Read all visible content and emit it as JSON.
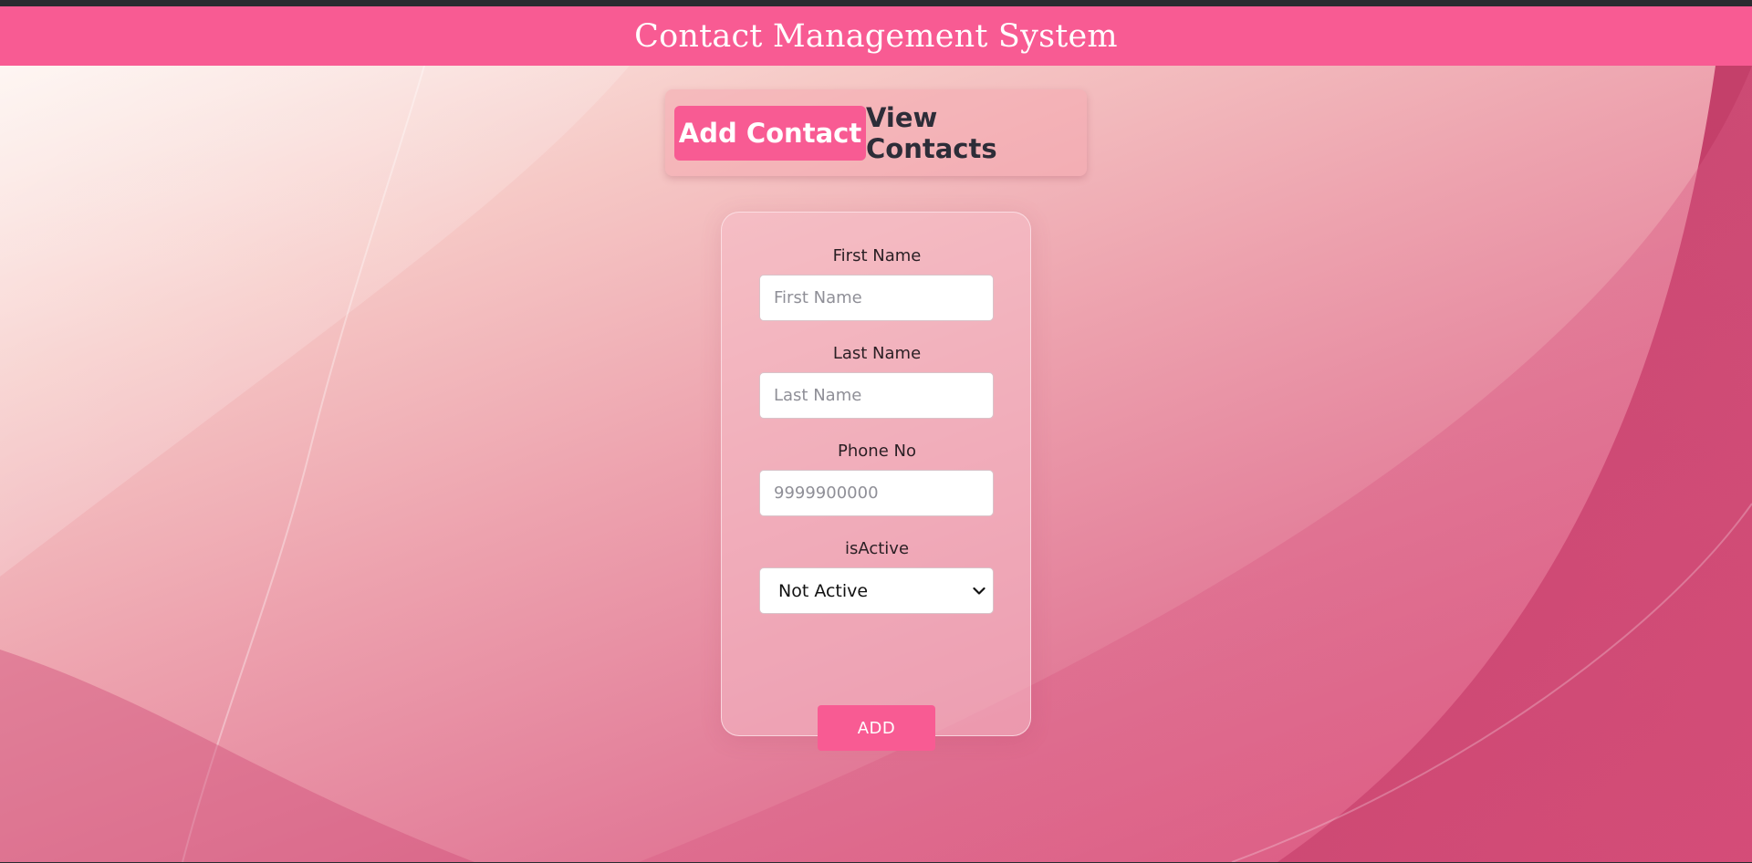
{
  "header": {
    "title": "Contact Management System"
  },
  "nav": {
    "tabs": [
      {
        "label": "Add Contact",
        "active": true
      },
      {
        "label": "View Contacts",
        "active": false
      }
    ]
  },
  "form": {
    "first_name": {
      "label": "First Name",
      "placeholder": "First Name",
      "value": ""
    },
    "last_name": {
      "label": "Last Name",
      "placeholder": "Last Name",
      "value": ""
    },
    "phone": {
      "label": "Phone No",
      "placeholder": "9999900000",
      "value": ""
    },
    "is_active": {
      "label": "isActive",
      "selected": "Not Active"
    },
    "submit_label": "ADD"
  },
  "colors": {
    "accent": "#f85b93",
    "text_dark": "#2d2d38"
  },
  "icons": {
    "select_arrow": "chevron-down-icon"
  }
}
